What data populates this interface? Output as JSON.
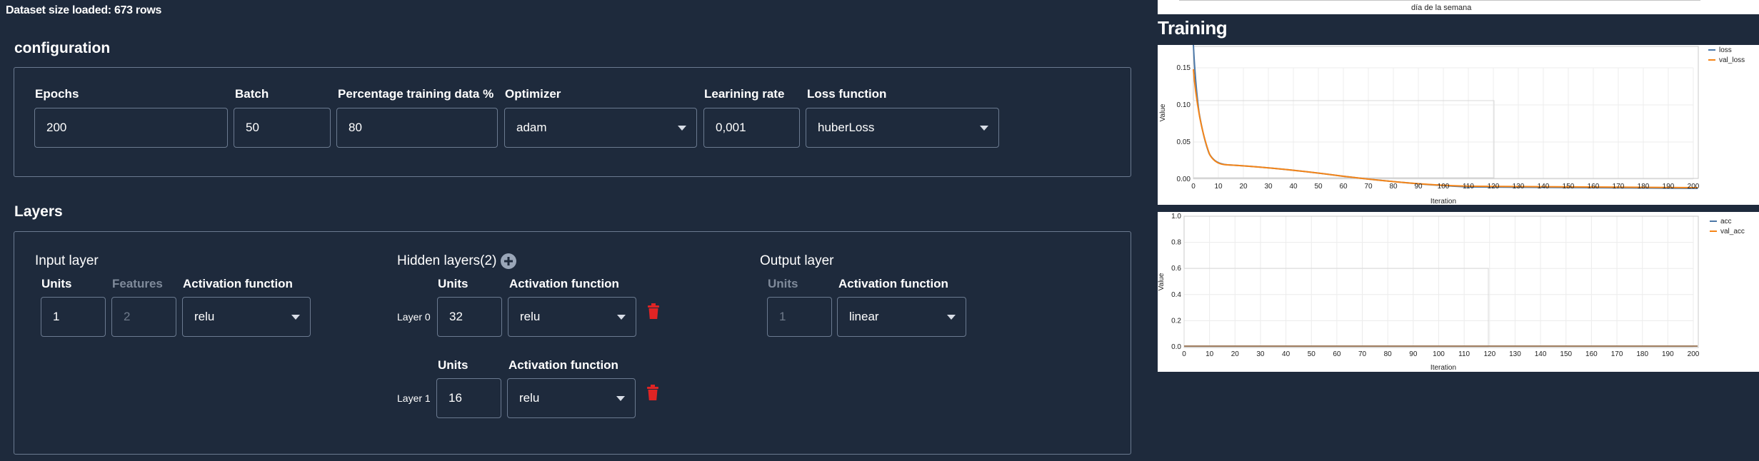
{
  "dataset_label": "Dataset size loaded: 673 rows",
  "configuration": {
    "title": "configuration",
    "fields": [
      {
        "label": "Epochs",
        "value": "200"
      },
      {
        "label": "Batch",
        "value": "50"
      },
      {
        "label": "Percentage training data %",
        "value": "80"
      },
      {
        "label": "Optimizer",
        "value": "adam"
      },
      {
        "label": "Learining rate",
        "value": "0,001"
      },
      {
        "label": "Loss function",
        "value": "huberLoss"
      }
    ]
  },
  "layers": {
    "title": "Layers",
    "input_layer": {
      "title": "Input layer",
      "units_label": "Units",
      "units_value": "1",
      "features_label": "Features",
      "features_value": "2",
      "activation_label": "Activation function",
      "activation_value": "relu"
    },
    "hidden_layers": {
      "title": "Hidden layers(2)",
      "add_icon": "plus-circle-icon",
      "delete_icon": "trash-icon",
      "items": [
        {
          "tag": "Layer 0",
          "units_label": "Units",
          "units_value": "32",
          "activation_label": "Activation function",
          "activation_value": "relu"
        },
        {
          "tag": "Layer 1",
          "units_label": "Units",
          "units_value": "16",
          "activation_label": "Activation function",
          "activation_value": "relu"
        }
      ]
    },
    "output_layer": {
      "title": "Output layer",
      "units_label": "Units",
      "units_value": "1",
      "activation_label": "Activation function",
      "activation_value": "linear"
    }
  },
  "training": {
    "title": "Training",
    "top_axis_label": "día de la semana",
    "loss_chart": {
      "ylabel": "Value",
      "xlabel": "Iteration",
      "yticks": [
        "0.15",
        "0.10",
        "0.05",
        "0.00"
      ],
      "xticks": [
        "0",
        "10",
        "20",
        "30",
        "40",
        "50",
        "60",
        "70",
        "80",
        "90",
        "100",
        "110",
        "120",
        "130",
        "140",
        "150",
        "160",
        "170",
        "180",
        "190",
        "200"
      ],
      "legend": [
        "loss",
        "val_loss"
      ]
    },
    "acc_chart": {
      "ylabel": "Value",
      "xlabel": "Iteration",
      "yticks": [
        "1.0",
        "0.8",
        "0.6",
        "0.4",
        "0.2",
        "0.0"
      ],
      "xticks": [
        "0",
        "10",
        "20",
        "30",
        "40",
        "50",
        "60",
        "70",
        "80",
        "90",
        "100",
        "110",
        "120",
        "130",
        "140",
        "150",
        "160",
        "170",
        "180",
        "190",
        "200"
      ],
      "legend": [
        "acc",
        "val_acc"
      ]
    }
  },
  "colors": {
    "background": "#1e2a3c",
    "series_blue": "#4c78a8",
    "series_orange": "#f58518",
    "trash": "#e02424"
  }
}
